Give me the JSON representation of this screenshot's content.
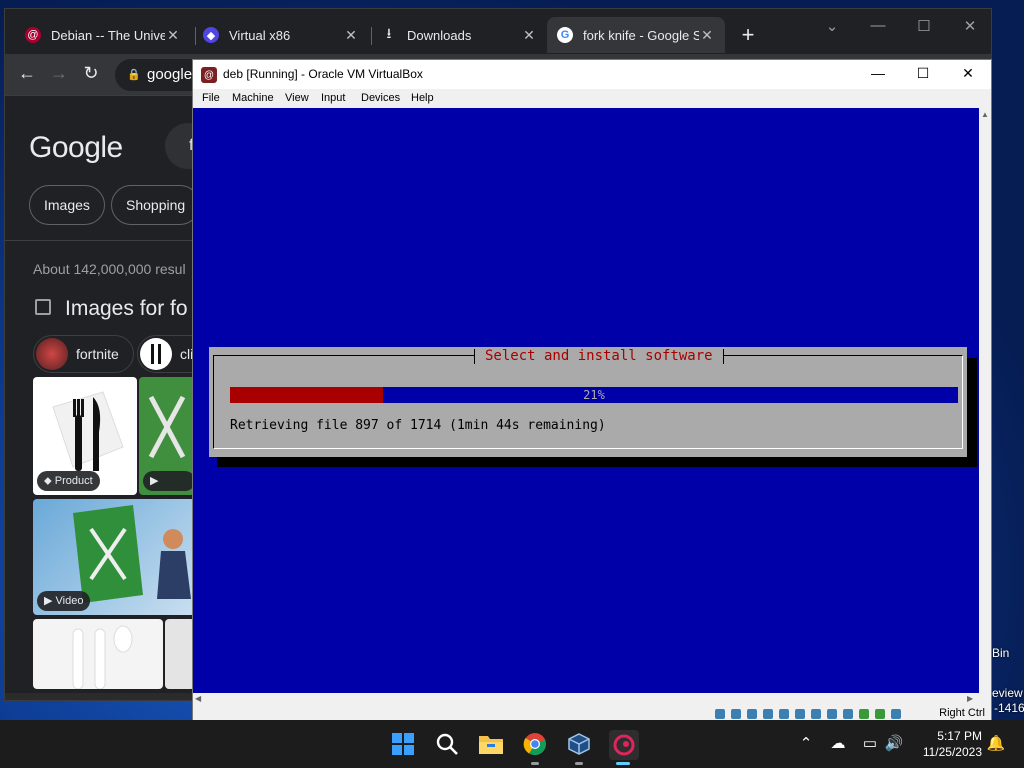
{
  "desktop": {
    "recycle_fragment": "Bin",
    "preview_fragment": "eview",
    "build_fragment": "-1416"
  },
  "chrome": {
    "tabs": [
      {
        "title": "Debian -- The Univer",
        "favicon": "debian-swirl-icon",
        "color": "#a80030"
      },
      {
        "title": "Virtual x86",
        "favicon": "virtual-x86-icon",
        "color": "#4f46e5"
      },
      {
        "title": "Downloads",
        "favicon": "download-icon",
        "color": "#e8eaed"
      },
      {
        "title": "fork knife - Google S",
        "favicon": "google-g-icon",
        "color": "#ffffff"
      }
    ],
    "new_tab": "+",
    "address": "google.",
    "google": {
      "logo": "Google",
      "query_fragment": "fo",
      "chips": [
        "Images",
        "Shopping"
      ],
      "result_count": "About 142,000,000 resul",
      "images_heading": "Images for fo",
      "suggestion_chips": [
        "fortnite",
        "cli"
      ],
      "badges": {
        "product": "Product",
        "video": "Video"
      }
    }
  },
  "vbox": {
    "title": "deb [Running] - Oracle VM VirtualBox",
    "menu": [
      "File",
      "Machine",
      "View",
      "Input",
      "Devices",
      "Help"
    ],
    "host_key": "Right Ctrl",
    "installer": {
      "title": "Select and install software",
      "progress": 21,
      "progress_label": "21%",
      "message": "Retrieving file 897 of 1714 (1min 44s remaining)"
    }
  },
  "taskbar": {
    "time": "5:17 PM",
    "date": "11/25/2023",
    "accent": "#0078d4"
  }
}
